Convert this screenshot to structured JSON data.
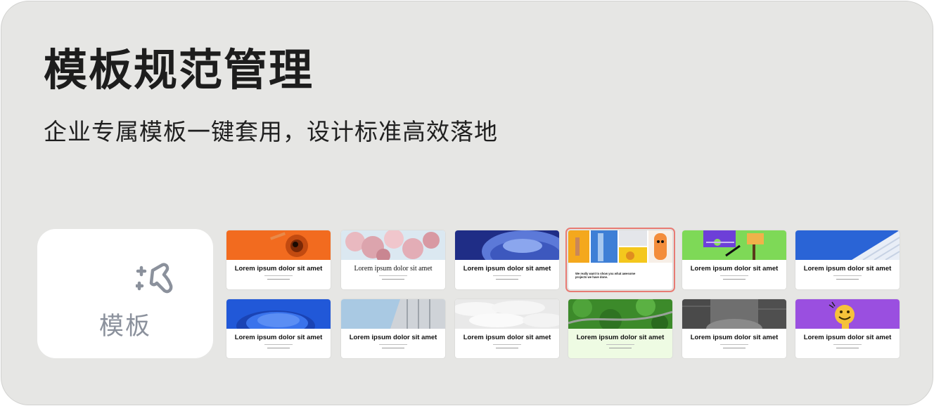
{
  "header": {
    "title": "模板规范管理",
    "subtitle": "企业专属模板一键套用，设计标准高效落地"
  },
  "tool": {
    "icon": "sparkle-brush-icon",
    "label": "模板"
  },
  "templates": {
    "caption": "Lorem ipsum dolor sit amet",
    "featured_text": "We really want to show you what awesome projects we have done.",
    "accent_color": "#e87b73"
  }
}
